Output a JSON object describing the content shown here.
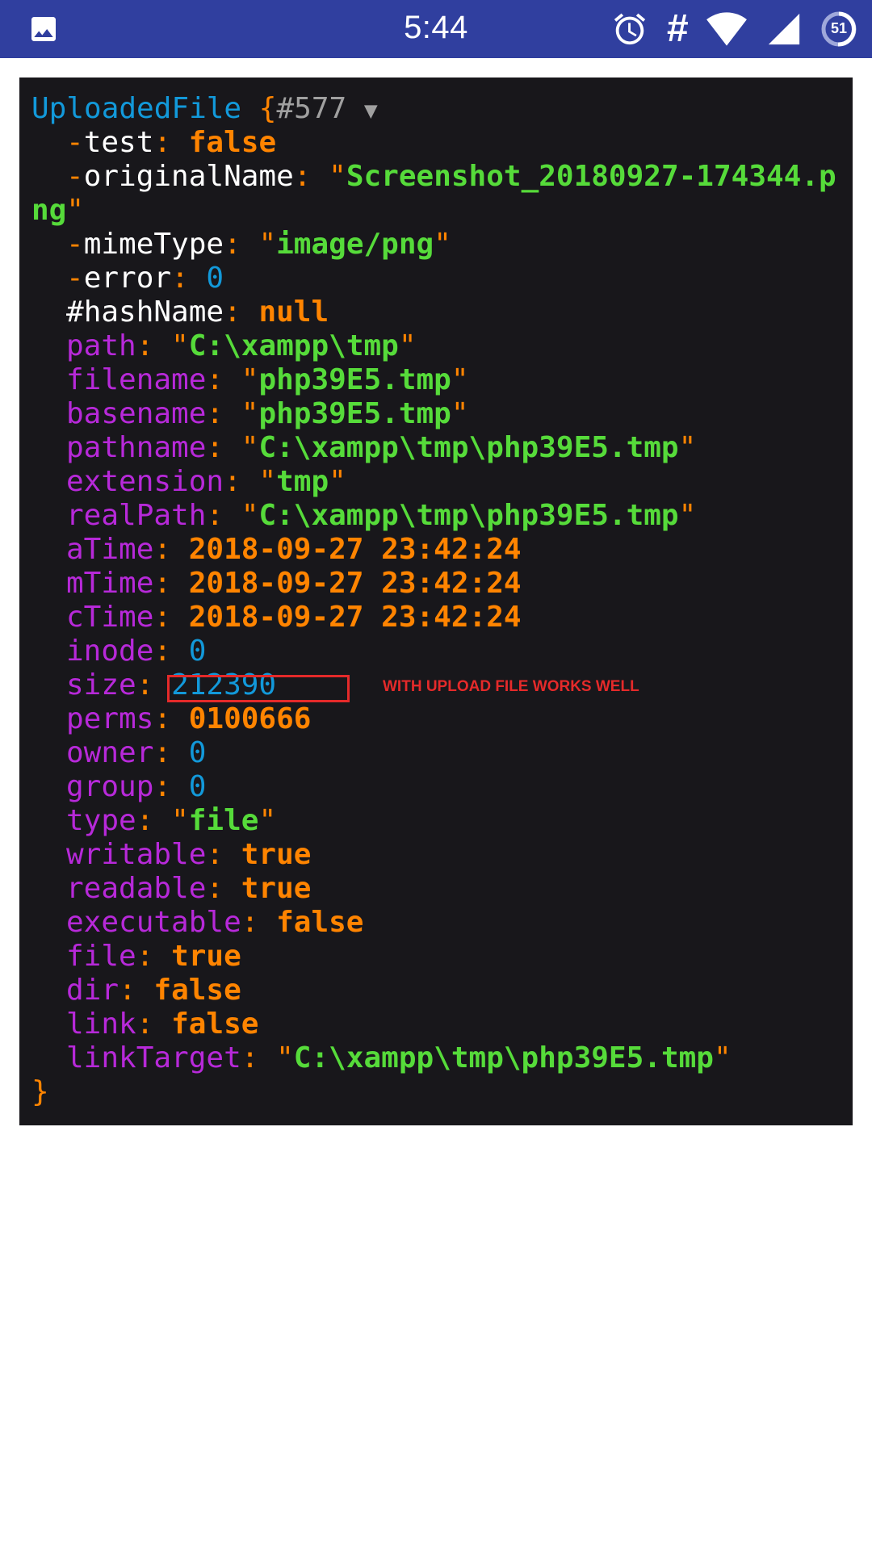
{
  "status_bar": {
    "time": "5:44",
    "hash_symbol": "#",
    "battery_level": "51",
    "icons": [
      "gallery-icon",
      "alarm-icon",
      "wifi-icon",
      "signal-icon",
      "battery-icon"
    ]
  },
  "dump": {
    "class_name": "UploadedFile",
    "open_brace": "{",
    "ref": "#577",
    "toggle": "▼",
    "close_brace": "}",
    "props": [
      {
        "prefix": "-",
        "key": "test",
        "value": "false",
        "kind": "kw"
      },
      {
        "prefix": "-",
        "key": "originalName",
        "value": "Screenshot_20180927-174344.p",
        "value_cont": "ng",
        "kind": "str"
      },
      {
        "prefix": "-",
        "key": "mimeType",
        "value": "image/png",
        "kind": "str"
      },
      {
        "prefix": "-",
        "key": "error",
        "value": "0",
        "kind": "num"
      },
      {
        "prefix": "#",
        "key": "hashName",
        "value": "null",
        "kind": "kw"
      },
      {
        "prefix": "",
        "key": "path",
        "value": "C:\\xampp\\tmp",
        "kind": "str"
      },
      {
        "prefix": "",
        "key": "filename",
        "value": "php39E5.tmp",
        "kind": "str"
      },
      {
        "prefix": "",
        "key": "basename",
        "value": "php39E5.tmp",
        "kind": "str"
      },
      {
        "prefix": "",
        "key": "pathname",
        "value": "C:\\xampp\\tmp\\php39E5.tmp",
        "kind": "str"
      },
      {
        "prefix": "",
        "key": "extension",
        "value": "tmp",
        "kind": "str"
      },
      {
        "prefix": "",
        "key": "realPath",
        "value": "C:\\xampp\\tmp\\php39E5.tmp",
        "kind": "str"
      },
      {
        "prefix": "",
        "key": "aTime",
        "value": "2018-09-27 23:42:24",
        "kind": "date"
      },
      {
        "prefix": "",
        "key": "mTime",
        "value": "2018-09-27 23:42:24",
        "kind": "date"
      },
      {
        "prefix": "",
        "key": "cTime",
        "value": "2018-09-27 23:42:24",
        "kind": "date"
      },
      {
        "prefix": "",
        "key": "inode",
        "value": "0",
        "kind": "num"
      },
      {
        "prefix": "",
        "key": "size",
        "value": "212390",
        "kind": "num"
      },
      {
        "prefix": "",
        "key": "perms",
        "value": "0100666",
        "kind": "date"
      },
      {
        "prefix": "",
        "key": "owner",
        "value": "0",
        "kind": "num"
      },
      {
        "prefix": "",
        "key": "group",
        "value": "0",
        "kind": "num"
      },
      {
        "prefix": "",
        "key": "type",
        "value": "file",
        "kind": "str"
      },
      {
        "prefix": "",
        "key": "writable",
        "value": "true",
        "kind": "kw"
      },
      {
        "prefix": "",
        "key": "readable",
        "value": "true",
        "kind": "kw"
      },
      {
        "prefix": "",
        "key": "executable",
        "value": "false",
        "kind": "kw"
      },
      {
        "prefix": "",
        "key": "file",
        "value": "true",
        "kind": "kw"
      },
      {
        "prefix": "",
        "key": "dir",
        "value": "false",
        "kind": "kw"
      },
      {
        "prefix": "",
        "key": "link",
        "value": "false",
        "kind": "kw"
      },
      {
        "prefix": "",
        "key": "linkTarget",
        "value": "C:\\xampp\\tmp\\php39E5.tmp",
        "kind": "str"
      }
    ]
  },
  "annotation": {
    "text": "WITH UPLOAD FILE WORKS WELL",
    "color": "#e52a2a"
  },
  "colors": {
    "status_bar": "#303f9f",
    "dump_bg": "#18171b",
    "class": "#1299da",
    "private_key": "#b729d9",
    "string": "#56db3a",
    "keyword": "#ff8400",
    "number": "#1299da"
  }
}
